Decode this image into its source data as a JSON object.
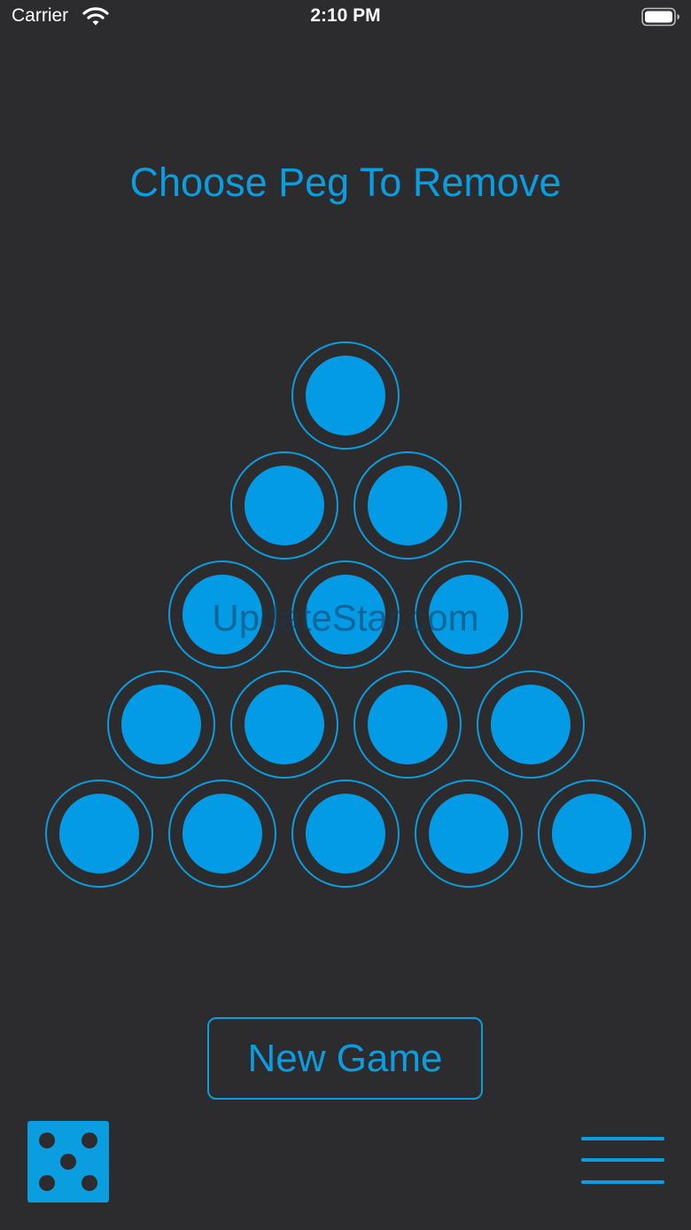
{
  "status_bar": {
    "carrier": "Carrier",
    "time": "2:10 PM",
    "wifi_icon": "wifi-icon",
    "battery_icon": "battery-icon"
  },
  "game": {
    "title": "Choose Peg To Remove",
    "rows": [
      [
        true
      ],
      [
        true,
        true
      ],
      [
        true,
        true,
        true
      ],
      [
        true,
        true,
        true,
        true
      ],
      [
        true,
        true,
        true,
        true,
        true
      ]
    ],
    "new_game_label": "New Game",
    "dice_icon": "dice-five-icon",
    "menu_icon": "menu-icon"
  },
  "watermark": "UpdateStar.com",
  "colors": {
    "background": "#2c2c2e",
    "accent": "#0a9de0",
    "peg": "#039be5"
  }
}
